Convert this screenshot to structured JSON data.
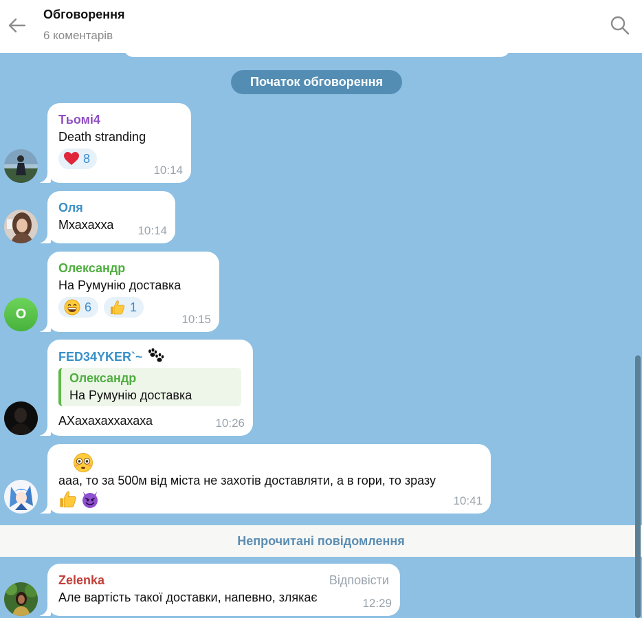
{
  "header": {
    "title": "Обговорення",
    "subtitle": "6 коментарів"
  },
  "service": {
    "label": "Початок обговорення"
  },
  "messages": [
    {
      "sender": "Тьомі4",
      "sender_color": "#8e4fc1",
      "text": "Death stranding",
      "time": "10:14",
      "reactions": [
        {
          "icon": "heart-icon",
          "count": "8"
        }
      ]
    },
    {
      "sender": "Оля",
      "sender_color": "#3a90c8",
      "text": "Мхахахха",
      "time": "10:14"
    },
    {
      "sender": "Олександр",
      "sender_color": "#4fae3f",
      "avatar_letter": "О",
      "text": "На Румунію доставка",
      "time": "10:15",
      "reactions": [
        {
          "icon": "grinning-face-icon",
          "count": "6"
        },
        {
          "icon": "thumbs-up-icon",
          "count": "1"
        }
      ]
    },
    {
      "sender": "FED34YKER`~",
      "sender_color": "#3a90c8",
      "sender_icon": "paw-prints-icon",
      "reply_to": {
        "sender": "Олександр",
        "text": "На Румунію доставка"
      },
      "text": "АХахахаххахаха",
      "time": "10:26"
    },
    {
      "text": "ааа, то за 500м від міста не захотів доставляти, а в гори, то зразу",
      "icons": [
        "flushed-face-icon",
        "thumbs-up-icon",
        "smiling-devil-icon"
      ],
      "time": "10:41"
    },
    {
      "sender": "Zelenka",
      "sender_color": "#c0403a",
      "reply_label": "Відповісти",
      "text": "Але вартість такої доставки, напевно, злякає",
      "time": "12:29"
    }
  ],
  "unread": {
    "label": "Непрочитані повідомлення"
  },
  "colors": {
    "chat_background": "#8ec0e4",
    "reaction_background": "#e6f1fa",
    "reaction_text": "#3a8bd0"
  }
}
